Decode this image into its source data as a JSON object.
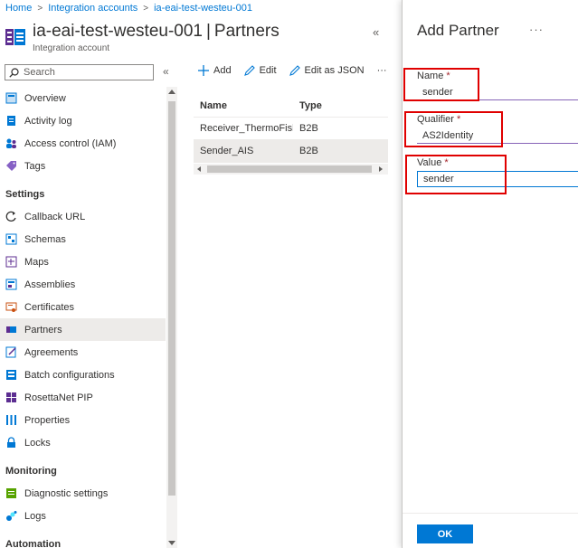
{
  "breadcrumb": {
    "items": [
      "Home",
      "Integration accounts",
      "ia-eai-test-westeu-001"
    ]
  },
  "header": {
    "resource_name": "ia-eai-test-westeu-001",
    "page_name": "Partners",
    "subtitle": "Integration account",
    "collapse_glyph": "«"
  },
  "search": {
    "placeholder": "Search",
    "collapse_glyph": "«"
  },
  "menu": {
    "general": [
      "Overview",
      "Activity log",
      "Access control (IAM)",
      "Tags"
    ],
    "settings_header": "Settings",
    "settings": [
      "Callback URL",
      "Schemas",
      "Maps",
      "Assemblies",
      "Certificates",
      "Partners",
      "Agreements",
      "Batch configurations",
      "RosettaNet PIP",
      "Properties",
      "Locks"
    ],
    "monitoring_header": "Monitoring",
    "monitoring": [
      "Diagnostic settings",
      "Logs"
    ],
    "automation_header": "Automation",
    "active_item": "Partners"
  },
  "toolbar": {
    "add": "Add",
    "edit": "Edit",
    "edit_json": "Edit as JSON",
    "more": "···"
  },
  "grid": {
    "columns": [
      "Name",
      "Type"
    ],
    "rows": [
      {
        "name": "Receiver_ThermoFish...",
        "type": "B2B"
      },
      {
        "name": "Sender_AIS",
        "type": "B2B"
      }
    ]
  },
  "panel": {
    "title": "Add Partner",
    "more": "···",
    "name_label": "Name",
    "name_value": "sender",
    "qualifier_label": "Qualifier",
    "qualifier_value": "AS2Identity",
    "value_label": "Value",
    "value_value": "sender",
    "required_mark": "*",
    "ok_label": "OK"
  },
  "colors": {
    "accent": "#0078d4",
    "highlight_red": "#e00000",
    "selected_bg": "#edebe9"
  }
}
